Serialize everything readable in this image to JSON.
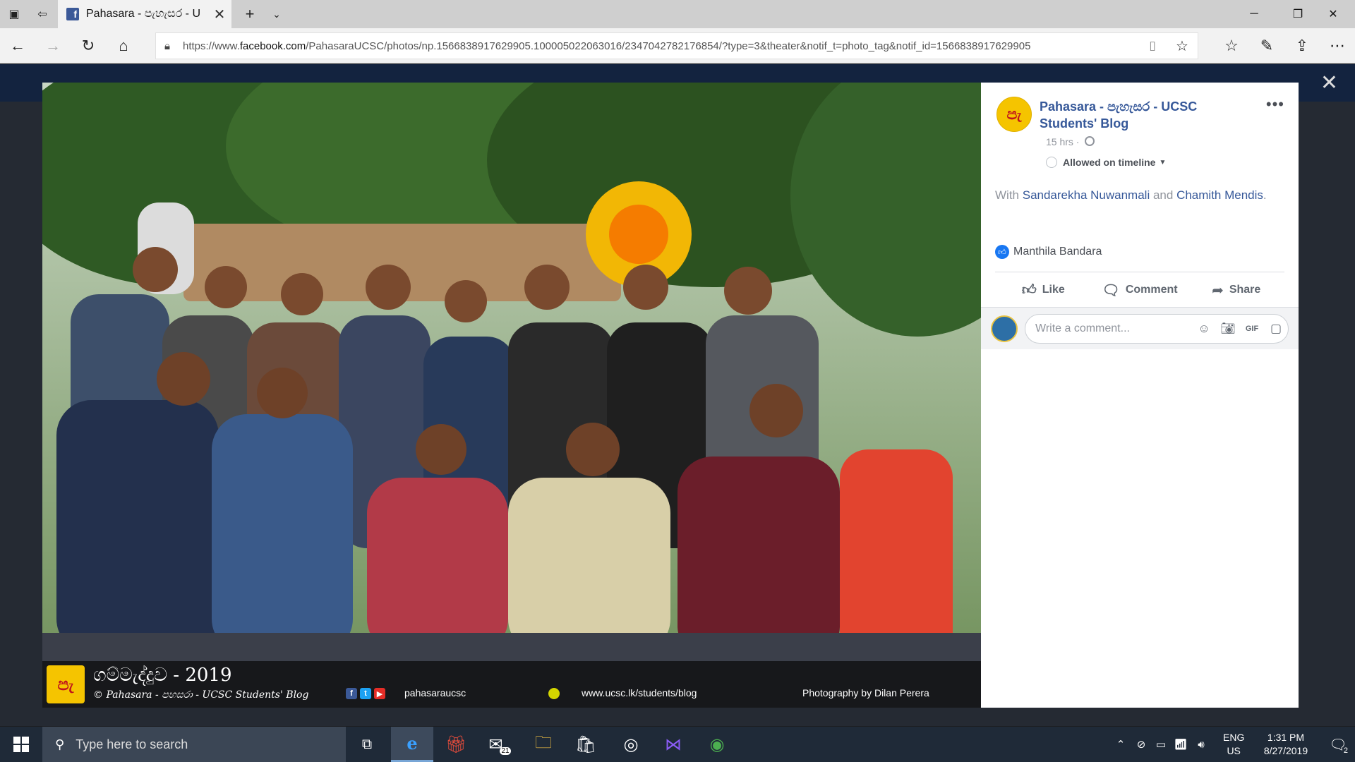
{
  "browser": {
    "tab_title": "Pahasara - පැහැසර - U",
    "tab_favicon": "f",
    "url_prefix": "https://www.",
    "url_domain": "facebook.com",
    "url_rest": "/PahasaraUCSC/photos/np.1566838917629905.100005022063016/2347042782176854/?type=3&theater&notif_t=photo_tag&notif_id=1566838917629905"
  },
  "photo": {
    "caption_title": "ගම්මැද්දුව - 2019",
    "caption_copyright": "© Pahasara - පහසරා - UCSC Students' Blog",
    "social_handle": "pahasaraucsc",
    "website": "www.ucsc.lk/students/blog",
    "photographer": "Photography by Dilan Perera",
    "logo_text": "පැ"
  },
  "post": {
    "page_logo_text": "පැ",
    "page_name": "Pahasara - පැහැසර - UCSC Students' Blog",
    "time": "15 hrs ·",
    "timeline_option": "Allowed on timeline",
    "with_prefix": "With",
    "tagged_1": "Sandarekha Nuwanmali",
    "with_and": "and",
    "tagged_2": "Chamith Mendis",
    "with_suffix": ".",
    "reaction_name": "Manthila Bandara",
    "actions": {
      "like": "Like",
      "comment": "Comment",
      "share": "Share"
    },
    "comment_placeholder": "Write a comment..."
  },
  "taskbar": {
    "search_placeholder": "Type here to search",
    "mail_badge": "21",
    "language_line1": "ENG",
    "language_line2": "US",
    "time": "1:31 PM",
    "date": "8/27/2019",
    "notification_count": "2"
  },
  "colors": {
    "facebook_link": "#365899",
    "facebook_blue": "#1877f2",
    "logo_yellow": "#f5c400",
    "logo_red": "#c0141b",
    "taskbar_bg": "#1f2a38"
  }
}
